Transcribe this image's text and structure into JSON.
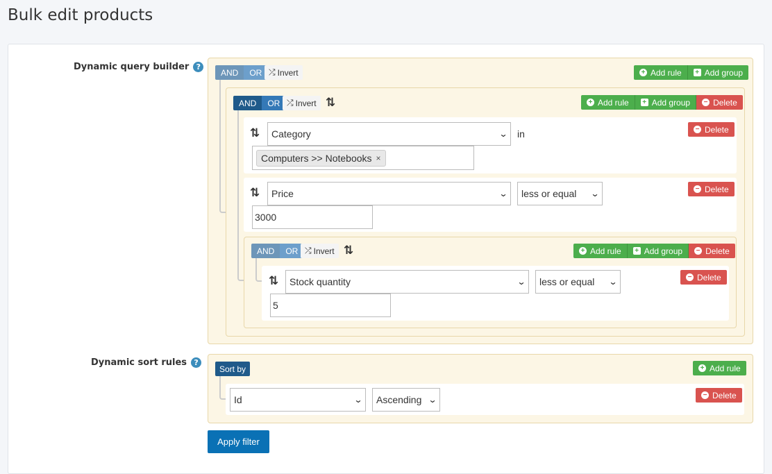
{
  "page_title": "Bulk edit products",
  "help_icon_glyph": "?",
  "query_builder": {
    "label": "Dynamic query builder",
    "root": {
      "and": "AND",
      "or": "OR",
      "invert": "Invert",
      "add_rule": "Add rule",
      "add_group": "Add group"
    },
    "group1": {
      "and": "AND",
      "or": "OR",
      "invert": "Invert",
      "add_rule": "Add rule",
      "add_group": "Add group",
      "delete": "Delete",
      "rules": [
        {
          "field": "Category",
          "operator": "in",
          "tag": "Computers >> Notebooks",
          "tag_remove": "×",
          "delete": "Delete"
        },
        {
          "field": "Price",
          "operator": "less or equal",
          "value": "3000",
          "delete": "Delete"
        }
      ],
      "group2": {
        "and": "AND",
        "or": "OR",
        "invert": "Invert",
        "add_rule": "Add rule",
        "add_group": "Add group",
        "delete": "Delete",
        "rules": [
          {
            "field": "Stock quantity",
            "operator": "less or equal",
            "value": "5",
            "delete": "Delete"
          }
        ]
      }
    }
  },
  "sort_rules": {
    "label": "Dynamic sort rules",
    "sort_by": "Sort by",
    "add_rule": "Add rule",
    "rules": [
      {
        "field": "Id",
        "direction": "Ascending",
        "delete": "Delete"
      }
    ]
  },
  "apply_button": "Apply filter",
  "icons": {
    "sort": "⇅",
    "shuffle": "⤮",
    "plus": "+",
    "minus": "−",
    "chevron": "⌄"
  },
  "colors": {
    "group_bg": "#fcf6e5",
    "group_border": "#e8d7a9",
    "and_active": "#1f5a8a",
    "green": "#4cae4c",
    "red": "#d9534f",
    "apply": "#0a71b5"
  }
}
